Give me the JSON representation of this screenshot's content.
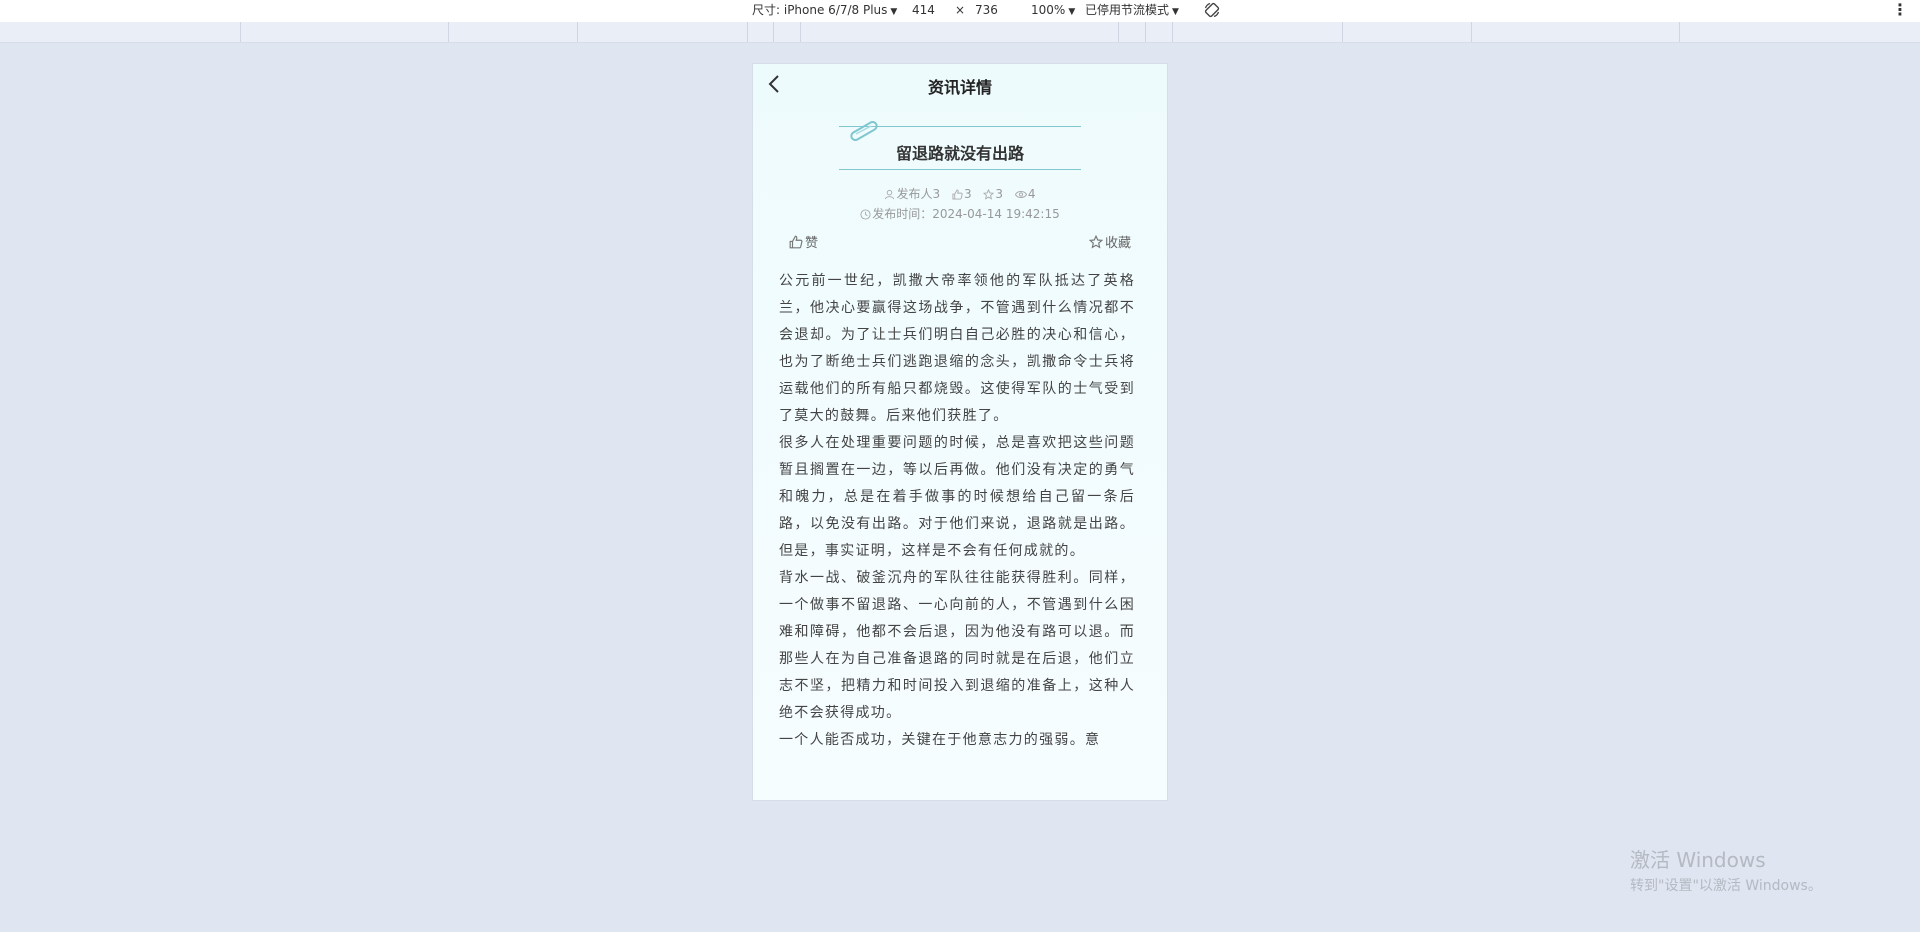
{
  "devtools": {
    "size_label": "尺寸: iPhone 6/7/8 Plus",
    "width_value": "414",
    "times": "×",
    "height_value": "736",
    "zoom": "100%",
    "throttle": "已停用节流模式"
  },
  "nav": {
    "title": "资讯详情"
  },
  "article": {
    "title": "留退路就没有出路",
    "publisher": "发布人3",
    "likes": "3",
    "favorites": "3",
    "views": "4",
    "publish_time": "发布时间：2024-04-14 19:42:15",
    "like_label": "赞",
    "favorite_label": "收藏",
    "paragraphs": [
      "公元前一世纪，凯撒大帝率领他的军队抵达了英格兰，他决心要赢得这场战争，不管遇到什么情况都不会退却。为了让士兵们明白自己必胜的决心和信心，也为了断绝士兵们逃跑退缩的念头，凯撒命令士兵将运载他们的所有船只都烧毁。这使得军队的士气受到了莫大的鼓舞。后来他们获胜了。",
      "很多人在处理重要问题的时候，总是喜欢把这些问题暂且搁置在一边，等以后再做。他们没有决定的勇气和魄力，总是在着手做事的时候想给自己留一条后路，以免没有出路。对于他们来说，退路就是出路。但是，事实证明，这样是不会有任何成就的。",
      "背水一战、破釜沉舟的军队往往能获得胜利。同样，一个做事不留退路、一心向前的人，不管遇到什么困难和障碍，他都不会后退，因为他没有路可以退。而那些人在为自己准备退路的同时就是在后退，他们立志不坚，把精力和时间投入到退缩的准备上，这种人绝不会获得成功。",
      "一个人能否成功，关键在于他意志力的强弱。意"
    ]
  },
  "watermark": {
    "line1": "激活 Windows",
    "line2": "转到\"设置\"以激活 Windows。"
  }
}
